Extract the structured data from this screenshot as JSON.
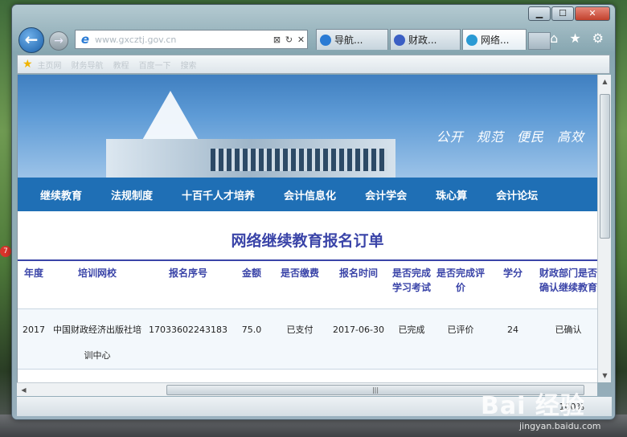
{
  "browser": {
    "address": "www.gxcztj.gov.cn",
    "tabs": [
      {
        "label": "导航..."
      },
      {
        "label": "财政..."
      },
      {
        "label": "网络..."
      }
    ],
    "favorites": [
      "主页网",
      "财务导航",
      "教程",
      "百度一下",
      "搜索"
    ],
    "zoom": "100%"
  },
  "site": {
    "slogan": "公开 规范 便民 高效",
    "menu": [
      "继续教育",
      "法规制度",
      "十百千人才培养",
      "会计信息化",
      "会计学会",
      "珠心算",
      "会计论坛"
    ],
    "page_title": "网络继续教育报名订单"
  },
  "table": {
    "headers": [
      "年度",
      "培训网校",
      "报名序号",
      "金额",
      "是否缴费",
      "报名时间",
      "是否完成学习考试",
      "是否完成评价",
      "学分",
      "财政部门是否确认继续教育"
    ],
    "rows": [
      {
        "year": "2017",
        "school": "中国财政经济出版社培训中心",
        "serial": "17033602243183",
        "amount": "75.0",
        "paid": "已支付",
        "date": "2017-06-30",
        "exam": "已完成",
        "review": "已评价",
        "credits": "24",
        "confirmed": "已确认"
      }
    ]
  },
  "desktop": {
    "badge": "7",
    "watermark_main": "Bai 经验",
    "watermark_sub": "jingyan.baidu.com"
  }
}
